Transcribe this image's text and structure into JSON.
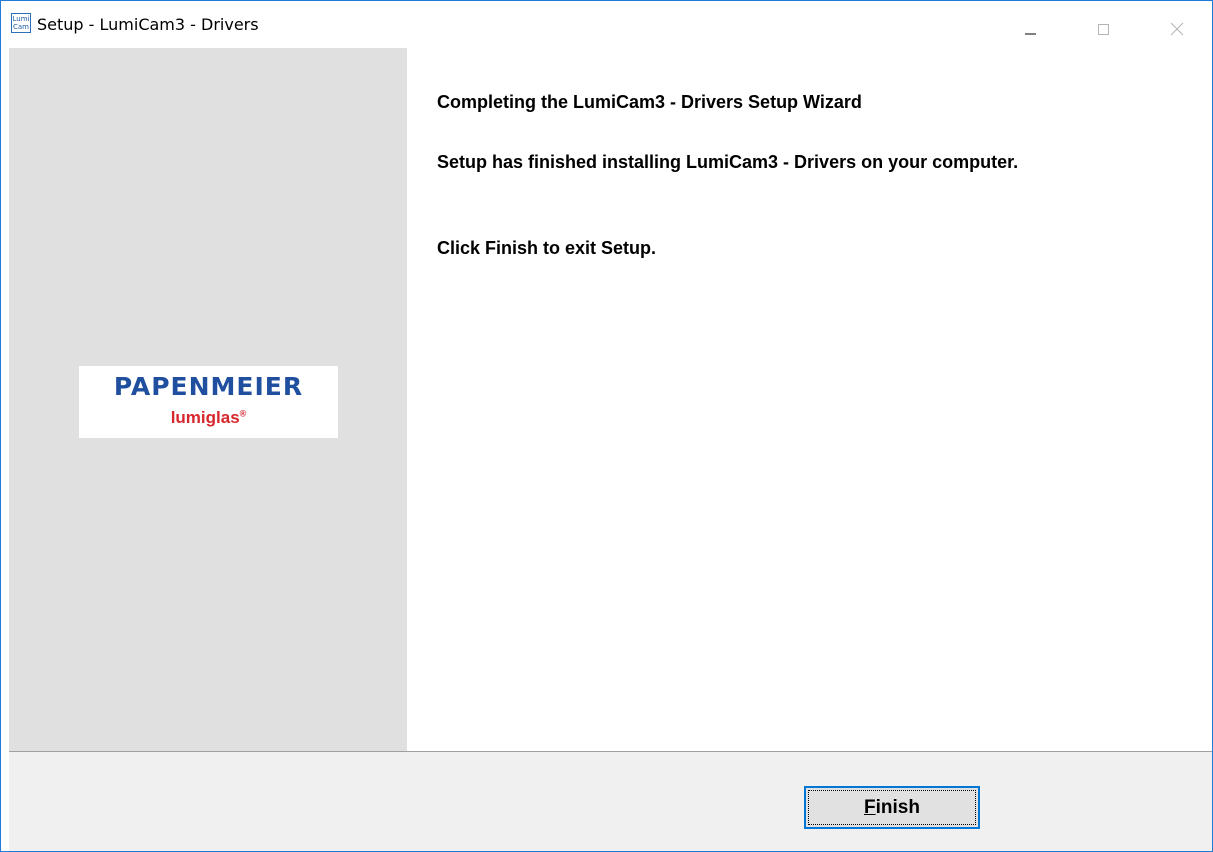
{
  "window": {
    "title": "Setup - LumiCam3 - Drivers",
    "app_icon_text_line1": "Lumi",
    "app_icon_text_line2": "Cam"
  },
  "sidebar": {
    "logo_brand": "PAPENMEIER",
    "logo_product": "lumiglas",
    "logo_mark": "®",
    "background_color": "#e0e0e0"
  },
  "content": {
    "heading": "Completing the LumiCam3 - Drivers Setup Wizard",
    "message": "Setup has finished installing LumiCam3 - Drivers on your computer.",
    "instruction": "Click Finish to exit Setup."
  },
  "footer": {
    "finish_mnemonic": "F",
    "finish_rest": "inish"
  },
  "colors": {
    "window_border": "#1e7bd8",
    "button_focus": "#0078d7",
    "brand_blue": "#1f4f9e",
    "brand_red": "#d7262c"
  }
}
